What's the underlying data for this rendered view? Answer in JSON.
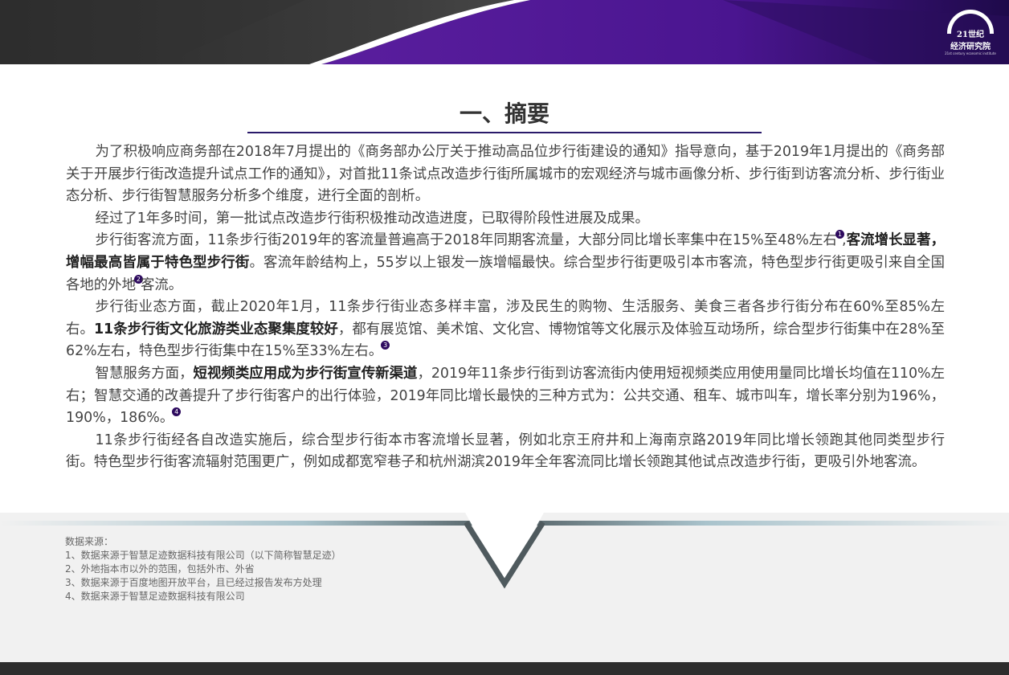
{
  "logo": {
    "line1": "21世纪",
    "line2": "经济研究院",
    "line3": "21st century economic institute"
  },
  "title": "一、摘要",
  "paragraphs": {
    "p1": "为了积极响应商务部在2018年7月提出的《商务部办公厅关于推动高品位步行街建设的通知》指导意向，基于2019年1月提出的《商务部关于开展步行街改造提升试点工作的通知》，对首批11条试点改造步行街所属城市的宏观经济与城市画像分析、步行街到访客流分析、步行街业态分析、步行街智慧服务分析多个维度，进行全面的剖析。",
    "p2": "经过了1年多时间，第一批试点改造步行街积极推动改造进度，已取得阶段性进展及成果。",
    "p3a": "步行街客流方面，11条步行街2019年的客流量普遍高于2018年同期客流量，大部分同比增长率集中在15%至48%左右",
    "p3b": ",",
    "p3bold": "客流增长显著，增幅最高皆属于特色型步行街",
    "p3c": "。客流年龄结构上，55岁以上银发一族增幅最快。综合型步行街更吸引本市客流，特色型步行街更吸引来自全国各地的外地",
    "p3d": "客流。",
    "p4a": "步行街业态方面，截止2020年1月，11条步行街业态多样丰富，涉及民生的购物、生活服务、美食三者各步行街分布在60%至85%左右。",
    "p4bold": "11条步行街文化旅游类业态聚集度较好",
    "p4c": "，都有展览馆、美术馆、文化宫、博物馆等文化展示及体验互动场所，综合型步行街集中在28%至62%左右，特色型步行街集中在15%至33%左右。",
    "p5a": "智慧服务方面，",
    "p5bold": "短视频类应用成为步行街宣传新渠道",
    "p5c": "，2019年11条步行街到访客流街内使用短视频类应用使用量同比增长均值在110%左右；智慧交通的改善提升了步行街客户的出行体验，2019年同比增长最快的三种方式为：公共交通、租车、城市叫车，增长率分别为196%，190%，186%。",
    "p6": "11条步行街经各自改造实施后，综合型步行街本市客流增长显著，例如北京王府井和上海南京路2019年同比增长领跑其他同类型步行街。特色型步行街客流辐射范围更广，例如成都宽窄巷子和杭州湖滨2019年全年客流同比增长领跑其他试点改造步行街，更吸引外地客流。"
  },
  "footnote_markers": [
    "1",
    "2",
    "3",
    "4"
  ],
  "notes": {
    "heading": "数据来源：",
    "items": [
      "1、数据来源于智慧足迹数据科技有限公司（以下简称智慧足迹）",
      "2、外地指本市以外的范围，包括外市、外省",
      "3、数据来源于百度地图开放平台，且已经过报告发布方处理",
      "4、数据来源于智慧足迹数据科技有限公司"
    ]
  },
  "colors": {
    "accent": "#2d0a5e",
    "purple": "#4a1590"
  }
}
